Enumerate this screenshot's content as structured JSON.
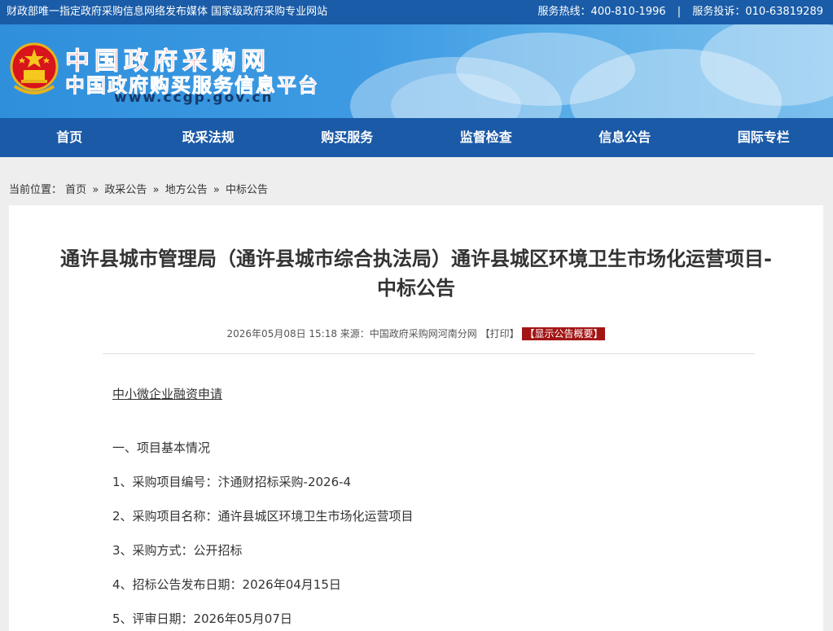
{
  "topbar": {
    "left_text": "财政部唯一指定政府采购信息网络发布媒体 国家级政府采购专业网站",
    "hotline": "服务热线：400-810-1996",
    "separator": "|",
    "complaint": "服务投诉：010-63819289"
  },
  "header": {
    "title_line1": "中国政府采购网",
    "title_line2": "中国政府购买服务信息平台",
    "url": "www.ccgp.gov.cn"
  },
  "nav": {
    "items": [
      "首页",
      "政采法规",
      "购买服务",
      "监督检查",
      "信息公告",
      "国际专栏"
    ]
  },
  "breadcrumb": {
    "prefix": "当前位置：",
    "items": [
      "首页",
      "政采公告",
      "地方公告",
      "中标公告"
    ],
    "arrow": "»"
  },
  "article": {
    "title_line1": "通许县城市管理局（通许县城市综合执法局）通许县城区环境卫生市场化运营项目-",
    "title_line2": "中标公告",
    "meta_text": "2026年05月08日 15:18 来源：中国政府采购网河南分网 【打印】",
    "summary_badge": "【显示公告概要】",
    "finance_link": "中小微企业融资申请",
    "lines": [
      "一、项目基本情况",
      "1、采购项目编号：汴通财招标采购-2026-4",
      "2、采购项目名称：通许县城区环境卫生市场化运营项目",
      "3、采购方式：公开招标",
      "4、招标公告发布日期：2026年04月15日",
      "5、评审日期：2026年05月07日"
    ]
  },
  "colors": {
    "topbar": "#1a5ca7",
    "nav": "#1b5aa6",
    "title_red": "#d8141c",
    "badge": "#a31515"
  }
}
